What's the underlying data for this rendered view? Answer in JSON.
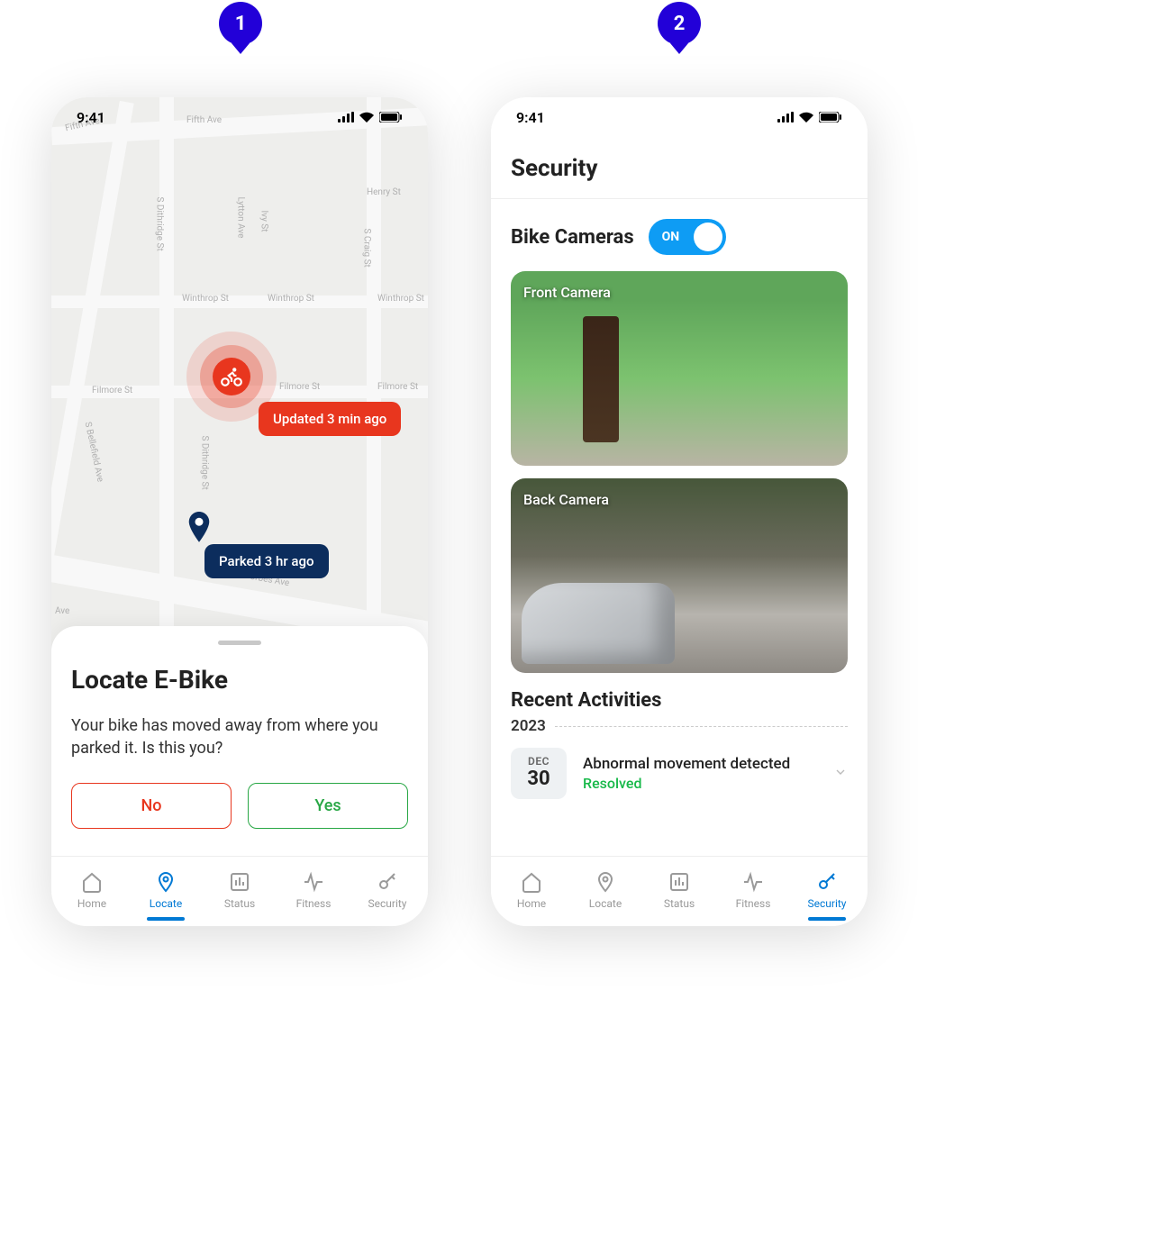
{
  "callouts": {
    "one": "1",
    "two": "2"
  },
  "statusBar": {
    "time": "9:41"
  },
  "phone1": {
    "map": {
      "updateTag": "Updated 3 min ago",
      "parkedTag": "Parked 3 hr ago",
      "streets": {
        "fifthAve": "Fifth Ave",
        "fifthAve2": "Fifth Ave",
        "henry": "Henry St",
        "dithridge1": "S Dithridge St",
        "dithridge2": "S Dithridge St",
        "lytton": "Lytton Ave",
        "ivy": "Ivy St",
        "craig": "S Craig St",
        "winthrop1": "Winthrop St",
        "winthrop2": "Winthrop St",
        "winthrop3": "Winthrop St",
        "filmore1": "Filmore St",
        "filmore2": "Filmore St",
        "filmore3": "Filmore St",
        "bellefield": "S Bellefield Ave",
        "forbes": "Forbes Ave",
        "ave": "Ave"
      }
    },
    "sheet": {
      "title": "Locate E-Bike",
      "body": "Your bike has moved away from where you parked it. Is this you?",
      "noBtn": "No",
      "yesBtn": "Yes"
    },
    "tabs": {
      "home": "Home",
      "locate": "Locate",
      "status": "Status",
      "fitness": "Fitness",
      "security": "Security"
    }
  },
  "phone2": {
    "headerTitle": "Security",
    "camerasTitle": "Bike Cameras",
    "toggleLabel": "ON",
    "frontCamLabel": "Front Camera",
    "backCamLabel": "Back Camera",
    "recentTitle": "Recent Activities",
    "year": "2023",
    "activity": {
      "month": "DEC",
      "day": "30",
      "title": "Abnormal movement detected",
      "status": "Resolved"
    },
    "tabs": {
      "home": "Home",
      "locate": "Locate",
      "status": "Status",
      "fitness": "Fitness",
      "security": "Security"
    }
  }
}
